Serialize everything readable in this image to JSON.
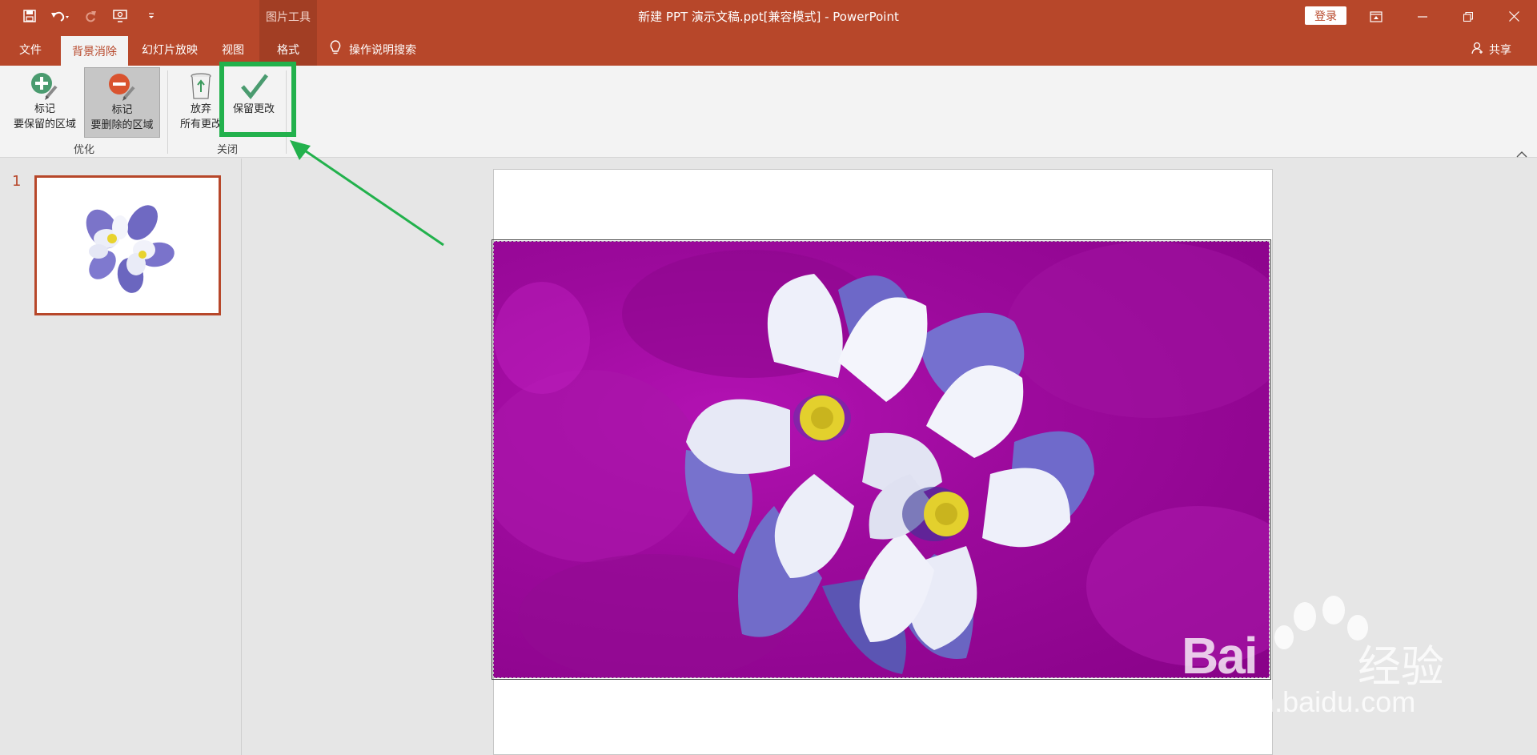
{
  "app": {
    "window_title": "新建 PPT 演示文稿.ppt[兼容模式]  -  PowerPoint",
    "login_label": "登录",
    "context_group_label": "图片工具"
  },
  "quick_access": {
    "icons": [
      "save-icon",
      "undo-icon",
      "redo-icon",
      "presenter-icon",
      "customize-icon"
    ]
  },
  "tabs": [
    {
      "label": "文件",
      "state": "normal"
    },
    {
      "label": "背景消除",
      "state": "active"
    },
    {
      "label": "幻灯片放映",
      "state": "normal"
    },
    {
      "label": "视图",
      "state": "normal"
    },
    {
      "label": "格式",
      "state": "context"
    }
  ],
  "tell_me": {
    "label": "操作说明搜索"
  },
  "share": {
    "label": "共享"
  },
  "ribbon": {
    "groups": [
      {
        "label": "优化",
        "buttons": [
          {
            "line1": "标记",
            "line2": "要保留的区域",
            "icon": "mark-keep-icon"
          },
          {
            "line1": "标记",
            "line2": "要删除的区域",
            "icon": "mark-remove-icon",
            "pressed": true
          }
        ]
      },
      {
        "label": "关闭",
        "buttons": [
          {
            "line1": "放弃",
            "line2": "所有更改",
            "icon": "discard-icon"
          },
          {
            "line1": "保留更改",
            "line2": "",
            "icon": "keep-changes-icon"
          }
        ]
      }
    ]
  },
  "slides_pane": {
    "slides": [
      {
        "number": "1"
      }
    ]
  },
  "watermark": {
    "main": "Bai",
    "cn": "经验",
    "sub": "jingyan.baidu.com"
  },
  "colors": {
    "accent": "#b7472a",
    "highlight": "#22b14c",
    "background_removed": "#9c0a9c"
  }
}
